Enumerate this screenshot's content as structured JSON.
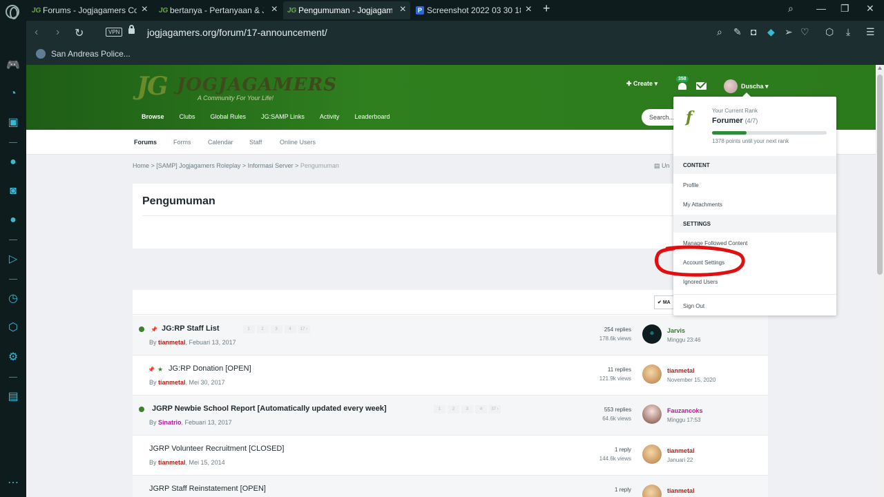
{
  "browser": {
    "tabs": [
      {
        "label": "Forums - Jogjagamers Com",
        "favicon": "JG"
      },
      {
        "label": "bertanya - Pertanyaan & Ja",
        "favicon": "JG"
      },
      {
        "label": "Pengumuman - Jogjagamer",
        "favicon": "JG"
      },
      {
        "label": "Screenshot 2022 03 30 183",
        "favicon": "P"
      }
    ],
    "url": "jogjagamers.org/forum/17-announcement/",
    "vpn_label": "VPN",
    "bookmark": "San Andreas Police...",
    "icons": [
      "search-icon",
      "snapshot-icon",
      "camera-icon",
      "shield-icon",
      "send-icon",
      "heart-icon",
      "cube-icon",
      "download-icon",
      "menu-icon"
    ]
  },
  "site": {
    "logo_jg": "JG",
    "logo_name": "JOGJAGAMERS",
    "logo_tagline": "A Community For Your Life!",
    "nav": [
      "Browse",
      "Clubs",
      "Global Rules",
      "JG:SAMP Links",
      "Activity",
      "Leaderboard"
    ],
    "create_label": "Create",
    "notification_count": "358",
    "username": "Duscha",
    "search_placeholder": "Search...",
    "subnav": [
      "Forums",
      "Forms",
      "Calendar",
      "Staff",
      "Online Users"
    ],
    "breadcrumbs": [
      "Home",
      "[SAMP] Jogjagamers Roleplay",
      "Informasi Server",
      "Pengumuman"
    ],
    "unread_label": "Un",
    "page_title": "Pengumuman",
    "mark_label": "MA"
  },
  "topics": [
    {
      "title": "JG:RP Staff List",
      "bold": true,
      "dot": true,
      "pinned": true,
      "starred": false,
      "pages": [
        "1",
        "2",
        "3",
        "4",
        "17"
      ],
      "author": "tianmetal",
      "author_pink": false,
      "date": "Febuari 13, 2017",
      "replies": "254 replies",
      "views": "178.6k views",
      "last_user": "Jarvis",
      "last_color": "#2f7d22",
      "last_date": "Minggu 23:46"
    },
    {
      "title": "JG:RP Donation [OPEN]",
      "bold": false,
      "dot": false,
      "pinned": true,
      "starred": true,
      "pages": [],
      "author": "tianmetal",
      "author_pink": false,
      "date": "Mei 30, 2017",
      "replies": "11 replies",
      "views": "121.9k views",
      "last_user": "tianmetal",
      "last_color": "#b0241c",
      "last_date": "November 15, 2020"
    },
    {
      "title": "JGRP Newbie School Report [Automatically updated every week]",
      "bold": true,
      "dot": true,
      "pinned": false,
      "starred": false,
      "pages": [
        "1",
        "2",
        "3",
        "4",
        "37"
      ],
      "author": "Sinatrio",
      "author_pink": true,
      "date": "Febuari 13, 2017",
      "replies": "553 replies",
      "views": "64.6k views",
      "last_user": "Fauzancoks",
      "last_color": "#b5179e",
      "last_date": "Minggu 17:53"
    },
    {
      "title": "JGRP Volunteer Recruitment [CLOSED]",
      "bold": false,
      "dot": false,
      "pinned": false,
      "starred": false,
      "pages": [],
      "author": "tianmetal",
      "author_pink": false,
      "date": "Mei 15, 2014",
      "replies": "1 reply",
      "views": "144.6k views",
      "last_user": "tianmetal",
      "last_color": "#b0241c",
      "last_date": "Januari 22"
    },
    {
      "title": "JGRP Staff Reinstatement [OPEN]",
      "bold": false,
      "dot": false,
      "pinned": false,
      "starred": false,
      "pages": [],
      "author": "",
      "author_pink": false,
      "date": "",
      "replies": "1 reply",
      "views": "",
      "last_user": "tianmetal",
      "last_color": "#b0241c",
      "last_date": ""
    }
  ],
  "user_menu": {
    "rank_caption": "Your Current Rank",
    "rank_name": "Forumer",
    "rank_fraction": "(4/7)",
    "rank_progress": 0.3,
    "rank_next": "1378 points until your next rank",
    "section_content": "CONTENT",
    "profile": "Profile",
    "attachments": "My Attachments",
    "section_settings": "SETTINGS",
    "followed": "Manage Followed Content",
    "account_settings": "Account Settings",
    "ignored": "Ignored Users",
    "sign_out": "Sign Out"
  }
}
